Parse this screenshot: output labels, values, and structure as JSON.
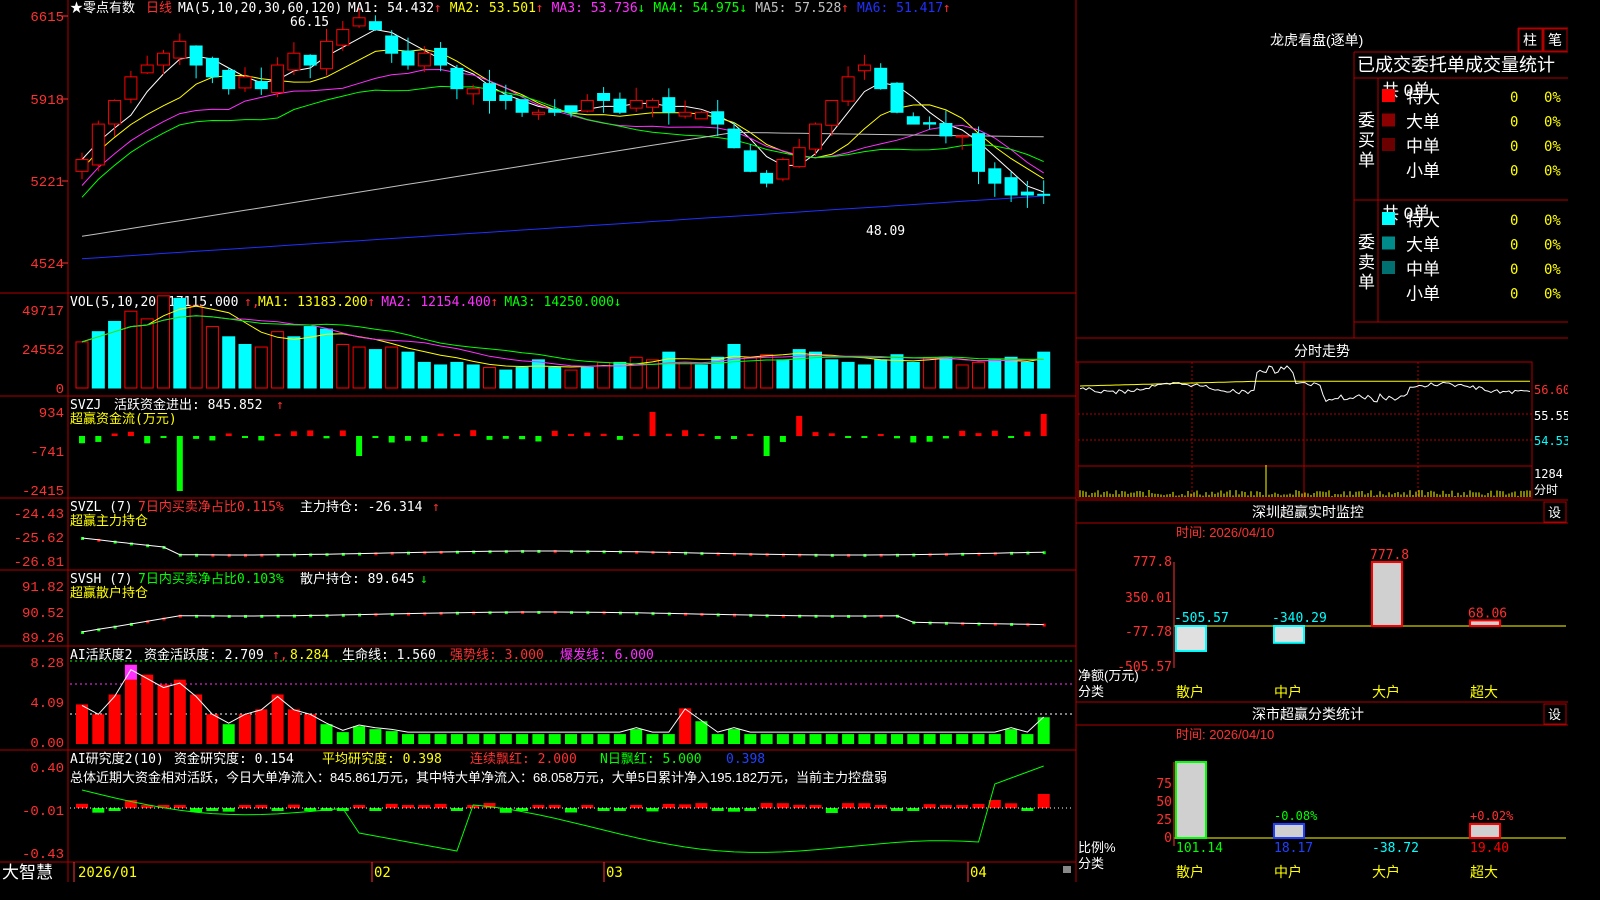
{
  "app": {
    "logo": "大智慧"
  },
  "main": {
    "title": "★零点有数",
    "period": "日线",
    "ma_label": "MA(5,10,20,30,60,120)",
    "ma_values": [
      {
        "label": "MA1: 54.432",
        "color": "#ffffff",
        "arrow": "↑",
        "arrow_color": "#ff3030"
      },
      {
        "label": "MA2: 53.501",
        "color": "#ffff00",
        "arrow": "↑",
        "arrow_color": "#ff3030"
      },
      {
        "label": "MA3: 53.736",
        "color": "#ff30ff",
        "arrow": "↓",
        "arrow_color": "#00ff00"
      },
      {
        "label": "MA4: 54.975",
        "color": "#00ff00",
        "arrow": "↓",
        "arrow_color": "#00ff00"
      },
      {
        "label": "MA5: 57.528",
        "color": "#c0c0c0",
        "arrow": "↑",
        "arrow_color": "#ff3030"
      },
      {
        "label": "MA6: 51.417",
        "color": "#2030ff",
        "arrow": "↑",
        "arrow_color": "#ff3030"
      }
    ],
    "y_ticks": [
      "6615",
      "5918",
      "5221",
      "4524"
    ],
    "high_label": "66.15",
    "low_label": "48.09"
  },
  "vol": {
    "title": "VOL(5,10,20)",
    "value": "17115.000",
    "ma": [
      {
        "label": "MA1: 13183.200",
        "color": "#ffff00",
        "arrow": "↑",
        "arrow_color": "#ff3030"
      },
      {
        "label": "MA2: 12154.400",
        "color": "#ff30ff",
        "arrow": "↑",
        "arrow_color": "#ff3030"
      },
      {
        "label": "MA3: 14250.000",
        "color": "#00ff00",
        "arrow": "↓",
        "arrow_color": "#00ff00"
      }
    ],
    "y_ticks": [
      "49717",
      "24552",
      "0"
    ]
  },
  "svzj": {
    "title": "SVZJ",
    "desc": "活跃资金进出: 845.852",
    "arrow": "↑",
    "sub": "超赢资金流(万元)",
    "y_ticks": [
      "934",
      "-741",
      "-2415"
    ]
  },
  "svzl": {
    "title": "SVZL (7)",
    "red_text": "7日内买卖净占比0.115%",
    "desc": "主力持仓: -26.314",
    "arrow": "↑",
    "sub": "超赢主力持仓",
    "y_ticks": [
      "-24.43",
      "-25.62",
      "-26.81"
    ]
  },
  "svsh": {
    "title": "SVSH (7)",
    "green_text": "7日内买卖净占比0.103%",
    "desc": "散户持仓: 89.645",
    "arrow": "↓",
    "sub": "超赢散户持仓",
    "y_ticks": [
      "91.82",
      "90.52",
      "89.26"
    ]
  },
  "ai1": {
    "title": "AI活跃度2",
    "desc": "资金活跃度: 2.709",
    "v2": "8.284",
    "v3": "生命线: 1.560",
    "v4": "强势线: 3.000",
    "v5": "爆发线: 6.000",
    "y_ticks": [
      "8.28",
      "4.09",
      "0.00"
    ]
  },
  "ai2": {
    "title": "AI研究度2(10)",
    "desc": "资金研究度: 0.154",
    "v2": "平均研究度: 0.398",
    "v3": "连续飘红: 2.000",
    "v4": "N日飘红: 5.000",
    "v5": "0.398",
    "summary": "总体近期大资金相对活跃，今日大单净流入：845.861万元，其中特大单净流入：68.058万元，大单5日累计净入195.182万元，当前主力控盘弱",
    "y_ticks": [
      "0.40",
      "-0.01",
      "-0.43"
    ]
  },
  "x_axis": [
    "2026/01",
    "02",
    "03",
    "04"
  ],
  "side": {
    "dragon_title": "龙虎看盘(逐单)",
    "tab1": "柱",
    "tab2": "笔",
    "subtitle": "已成交委托单成交量统计",
    "buy_group": "委买单",
    "sell_group": "委卖单",
    "buy_total": "共 0单",
    "sell_total": "共 0单",
    "buy_rows": [
      {
        "name": "特大",
        "qty": "0",
        "pct": "0%",
        "color": "#ff0000"
      },
      {
        "name": "大单",
        "qty": "0",
        "pct": "0%",
        "color": "#8b0000"
      },
      {
        "name": "中单",
        "qty": "0",
        "pct": "0%",
        "color": "#6b0000"
      },
      {
        "name": "小单",
        "qty": "0",
        "pct": "0%",
        "color": "#000000"
      }
    ],
    "sell_rows": [
      {
        "name": "特大",
        "qty": "0",
        "pct": "0%",
        "color": "#00ffff"
      },
      {
        "name": "大单",
        "qty": "0",
        "pct": "0%",
        "color": "#008b8b"
      },
      {
        "name": "中单",
        "qty": "0",
        "pct": "0%",
        "color": "#007070"
      },
      {
        "name": "小单",
        "qty": "0",
        "pct": "0%",
        "color": "#000000"
      }
    ],
    "intraday_title": "分时走势",
    "intraday_y": [
      "56.60",
      "55.55",
      "54.53"
    ],
    "intraday_vol": "1284",
    "intraday_unit": "分时",
    "monitor_title": "深圳超赢实时监控",
    "set_label": "设",
    "time_label": "时间: 2026/04/10",
    "monitor_y": [
      "777.8",
      "350.01",
      "-77.78",
      "-505.57"
    ],
    "monitor_unit": "净额(万元)",
    "category_label": "分类",
    "monitor_values": [
      {
        "label": "-505.57",
        "value": -505.57
      },
      {
        "label": "-340.29",
        "value": -340.29
      },
      {
        "label": "777.8",
        "value": 777.8
      },
      {
        "label": "68.06",
        "value": 68.06
      }
    ],
    "categories": [
      "散户",
      "中户",
      "大户",
      "超大"
    ],
    "stat_title": "深市超赢分类统计",
    "stat_y": [
      "75",
      "50",
      "25",
      "0"
    ],
    "stat_unit": "比例%",
    "stat_values": [
      {
        "label": "101.14",
        "value": 101.14
      },
      {
        "label": "18.17",
        "value": 18.17
      },
      {
        "label": "-38.72",
        "value": -38.72
      },
      {
        "label": "19.40",
        "value": 19.4
      }
    ],
    "stat_pcts": [
      "-0.08%",
      "+0.02%"
    ]
  },
  "colors": {
    "up": "#ff0000",
    "down": "#00ffff",
    "grid": "#b00000",
    "axis": "#ff3030"
  }
}
